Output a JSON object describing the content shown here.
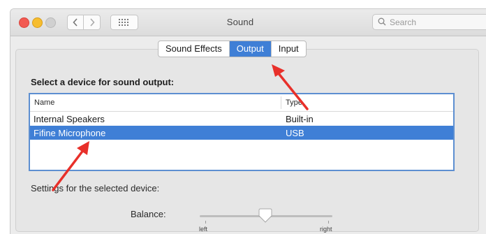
{
  "window": {
    "title": "Sound",
    "search_placeholder": "Search"
  },
  "toolbar": {
    "back_icon": "chevron-left-icon",
    "forward_icon": "chevron-right-icon",
    "grid_icon": "grid-icon"
  },
  "tabs": [
    {
      "label": "Sound Effects",
      "active": false
    },
    {
      "label": "Output",
      "active": true
    },
    {
      "label": "Input",
      "active": false
    }
  ],
  "output": {
    "section_title": "Select a device for sound output:",
    "columns": [
      "Name",
      "Type"
    ],
    "devices": [
      {
        "name": "Internal Speakers",
        "type": "Built-in",
        "selected": false
      },
      {
        "name": "Fifine Microphone",
        "type": "USB",
        "selected": true
      }
    ]
  },
  "settings": {
    "label": "Settings for the selected device:",
    "balance_label": "Balance:",
    "balance_value": 0.5,
    "left_label": "left",
    "right_label": "right"
  },
  "colors": {
    "accent": "#3f7fd6",
    "annotation": "#e8302a"
  }
}
